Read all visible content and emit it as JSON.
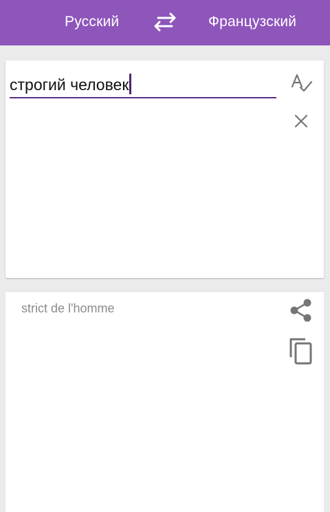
{
  "header": {
    "source_language": "Русский",
    "target_language": "Французский",
    "swap_icon": "swap-arrows-icon"
  },
  "input": {
    "value": "строгий человек",
    "spellcheck_icon": "spellcheck-icon",
    "clear_icon": "close-icon"
  },
  "output": {
    "translation": "strict de l'homme",
    "share_icon": "share-icon",
    "copy_icon": "copy-icon"
  },
  "colors": {
    "accent": "#8e55bb",
    "underline": "#5a2d82",
    "background": "#ebebeb",
    "icon_gray": "#757575"
  }
}
